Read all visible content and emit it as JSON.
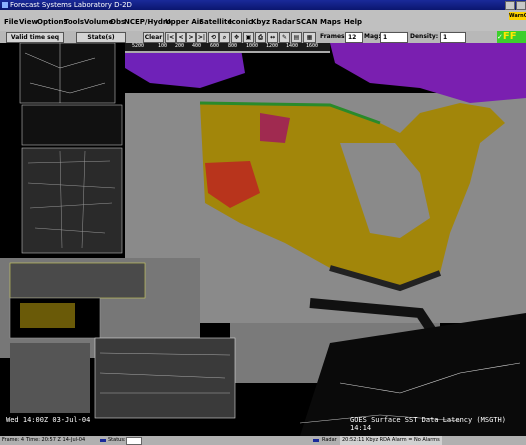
{
  "window": {
    "title": "Forecast Systems Laboratory D-2D"
  },
  "menu": [
    "File",
    "View",
    "Options",
    "Tools",
    "Volume",
    "Obs",
    "NCEP/Hydro",
    "Upper Air",
    "Satellite",
    "Iconic",
    "Kbyz",
    "Radar",
    "SCAN",
    "Maps",
    "Help"
  ],
  "warning_badge": "WarnGen",
  "toolbar": {
    "valid_time_label": "Valid time seq",
    "state_label": "State(s)",
    "clear_label": "Clear",
    "nav_buttons": [
      "|<",
      "<",
      ">",
      ">|"
    ],
    "frames_label": "Frames:",
    "frames_value": "12",
    "mag_label": "Mag:",
    "mag_value": "1",
    "density_label": "Density:",
    "density_value": "1",
    "status_ff": "FF"
  },
  "scale_labels": [
    "5200",
    "100",
    "200",
    "400",
    "600",
    "800",
    "1000",
    "1200",
    "1400",
    "1600"
  ],
  "overlays": {
    "left_datetime": "Wed 14:00Z 03-Jul-04",
    "right_product": "GOES Surface SST Data Latency (MSGTH) 14:14"
  },
  "status_bar": {
    "frame_label": "Frame: 4",
    "time_label": "Time: 20:57 Z 14-Jul-04",
    "status_label": "Status:",
    "radar_label": "Radar",
    "radar_message": "20:52:11 Kbyz RDA Alarm = No Alarms"
  },
  "colors": {
    "title_bg": "#0b1670",
    "menu_bg": "#c0c0c0",
    "status_green": "#3ccf2c",
    "warn_yellow": "#ffd200"
  }
}
